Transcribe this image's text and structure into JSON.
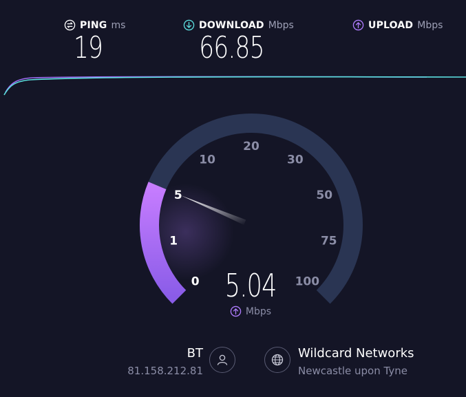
{
  "colors": {
    "background": "#141526",
    "download_accent": "#5ce0e0",
    "upload_accent": "#b07cff",
    "gauge_track": "#2a3553"
  },
  "ping": {
    "icon": "ping-icon",
    "label": "PING",
    "unit": "ms",
    "value": "19"
  },
  "download": {
    "icon": "download-arrow-icon",
    "label": "DOWNLOAD",
    "unit": "Mbps",
    "value": "66.85"
  },
  "upload": {
    "icon": "upload-arrow-icon",
    "label": "UPLOAD",
    "unit": "Mbps",
    "value": ""
  },
  "gauge": {
    "ticks": [
      "0",
      "1",
      "5",
      "10",
      "20",
      "30",
      "50",
      "75",
      "100"
    ],
    "current_value": "5.04",
    "unit": "Mbps",
    "unit_icon": "upload-arrow-icon",
    "phase": "upload"
  },
  "isp": {
    "name": "BT",
    "ip": "81.158.212.81",
    "icon": "user-icon"
  },
  "server": {
    "name": "Wildcard Networks",
    "location": "Newcastle upon Tyne",
    "icon": "globe-icon"
  }
}
